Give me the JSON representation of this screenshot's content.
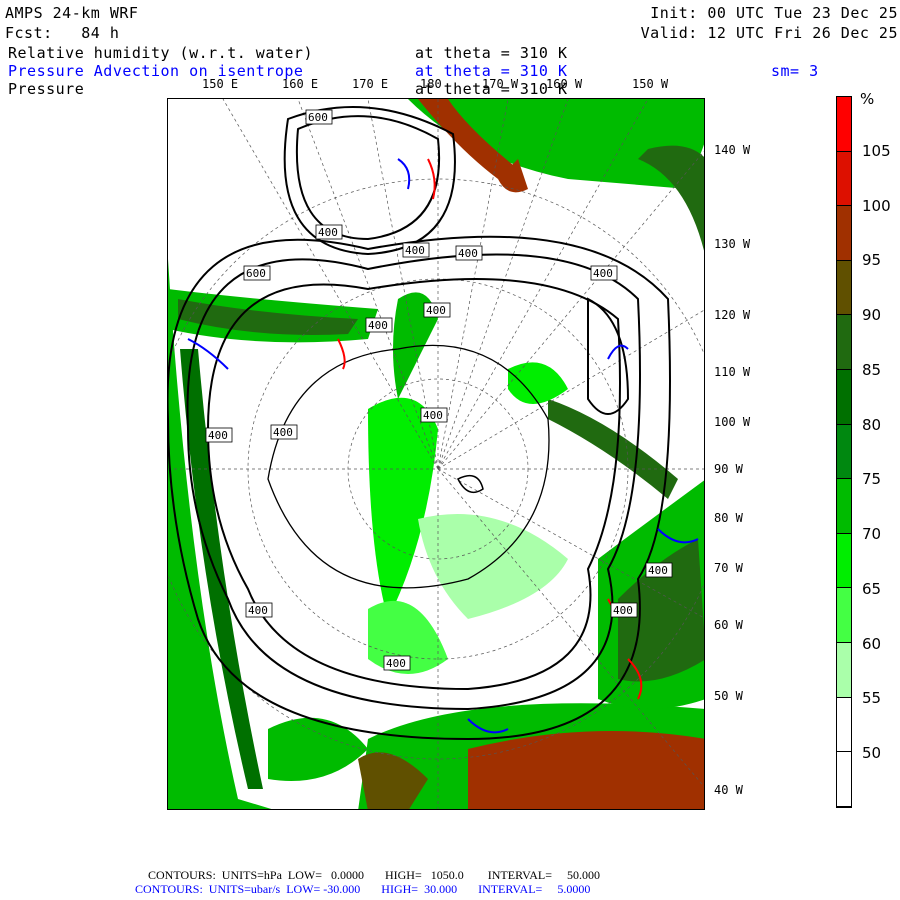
{
  "header": {
    "model": "AMPS 24-km WRF",
    "init": "Init: 00 UTC Tue 23 Dec 25",
    "fcst": "Fcst:   84 h",
    "valid": "Valid: 12 UTC Fri 26 Dec 25",
    "field1": "Relative humidity (w.r.t. water)",
    "field1_level": "at theta = 310 K",
    "field2": "Pressure Advection on isentrope",
    "field2_level": "at theta = 310 K",
    "smooth": "sm= 3",
    "field3": "Pressure",
    "field3_level": "at theta = 310 K"
  },
  "top_lon_labels": [
    "150 E",
    "160 E",
    "170 E",
    "180",
    "170 W",
    "160 W",
    "150 W"
  ],
  "right_lon_labels": [
    "140 W",
    "130 W",
    "120 W",
    "110 W",
    "100 W",
    "90 W",
    "80 W",
    "70 W",
    "60 W",
    "50 W",
    "40 W"
  ],
  "contour_labels": [
    "600",
    "400",
    "400",
    "400",
    "400",
    "600",
    "400",
    "400",
    "400",
    "400",
    "400",
    "400",
    "400",
    "400",
    "400"
  ],
  "colorbar": {
    "unit": "%",
    "labels": [
      "105",
      "100",
      "95",
      "90",
      "85",
      "80",
      "75",
      "70",
      "65",
      "60",
      "55",
      "50"
    ],
    "colors": [
      "#ff0000",
      "#dd1000",
      "#a03000",
      "#605000",
      "#206a10",
      "#007000",
      "#008810",
      "#00bb00",
      "#00ee00",
      "#44ff44",
      "#aaffaa",
      "#ffffff",
      "#ffffff"
    ]
  },
  "footer": {
    "line1": "CONTOURS:  UNITS=hPa  LOW=   0.0000       HIGH=   1050.0        INTERVAL=     50.000",
    "line2": "CONTOURS:  UNITS=ubar/s  LOW= -30.000       HIGH=  30.000       INTERVAL=     5.0000"
  }
}
